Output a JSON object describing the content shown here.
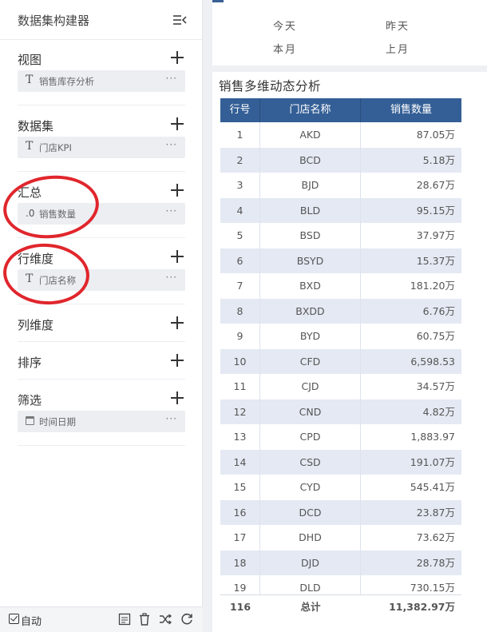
{
  "builder": {
    "title": "数据集构建器",
    "sections": {
      "view": {
        "title": "视图",
        "field": {
          "type_icon": "T",
          "label": "销售库存分析"
        }
      },
      "dataset": {
        "title": "数据集",
        "field": {
          "type_icon": "T",
          "label": "门店KPI"
        }
      },
      "summary": {
        "title": "汇总",
        "field": {
          "type_icon": ".0",
          "label": "销售数量"
        }
      },
      "row_dim": {
        "title": "行维度",
        "field": {
          "type_icon": "T",
          "label": "门店名称"
        }
      },
      "col_dim": {
        "title": "列维度"
      },
      "sort": {
        "title": "排序"
      },
      "filter": {
        "title": "筛选",
        "field": {
          "type_icon": "calendar-icon",
          "label": "时间日期"
        }
      }
    },
    "more_label": "···",
    "footer": {
      "auto_label": "自动"
    }
  },
  "quick_dates": {
    "today": "今天",
    "yesterday": "昨天",
    "this_month": "本月",
    "last_month": "上月"
  },
  "report": {
    "title": "销售多维动态分析",
    "columns": [
      "行号",
      "门店名称",
      "销售数量"
    ],
    "rows": [
      [
        "1",
        "AKD",
        "87.05万"
      ],
      [
        "2",
        "BCD",
        "5.18万"
      ],
      [
        "3",
        "BJD",
        "28.67万"
      ],
      [
        "4",
        "BLD",
        "95.15万"
      ],
      [
        "5",
        "BSD",
        "37.97万"
      ],
      [
        "6",
        "BSYD",
        "15.37万"
      ],
      [
        "7",
        "BXD",
        "181.20万"
      ],
      [
        "8",
        "BXDD",
        "6.76万"
      ],
      [
        "9",
        "BYD",
        "60.75万"
      ],
      [
        "10",
        "CFD",
        "6,598.53"
      ],
      [
        "11",
        "CJD",
        "34.57万"
      ],
      [
        "12",
        "CND",
        "4.82万"
      ],
      [
        "13",
        "CPD",
        "1,883.97"
      ],
      [
        "14",
        "CSD",
        "191.07万"
      ],
      [
        "15",
        "CYD",
        "545.41万"
      ],
      [
        "16",
        "DCD",
        "23.87万"
      ],
      [
        "17",
        "DHD",
        "73.62万"
      ],
      [
        "18",
        "DJD",
        "28.78万"
      ],
      [
        "19",
        "DLD",
        "730.15万"
      ]
    ],
    "footer": {
      "count": "116",
      "total_label": "总计",
      "total_value": "11,382.97万"
    }
  },
  "colors": {
    "header_bg": "#345f96",
    "alt_row": "#e4e9f3",
    "annotation": "#e0262c"
  }
}
